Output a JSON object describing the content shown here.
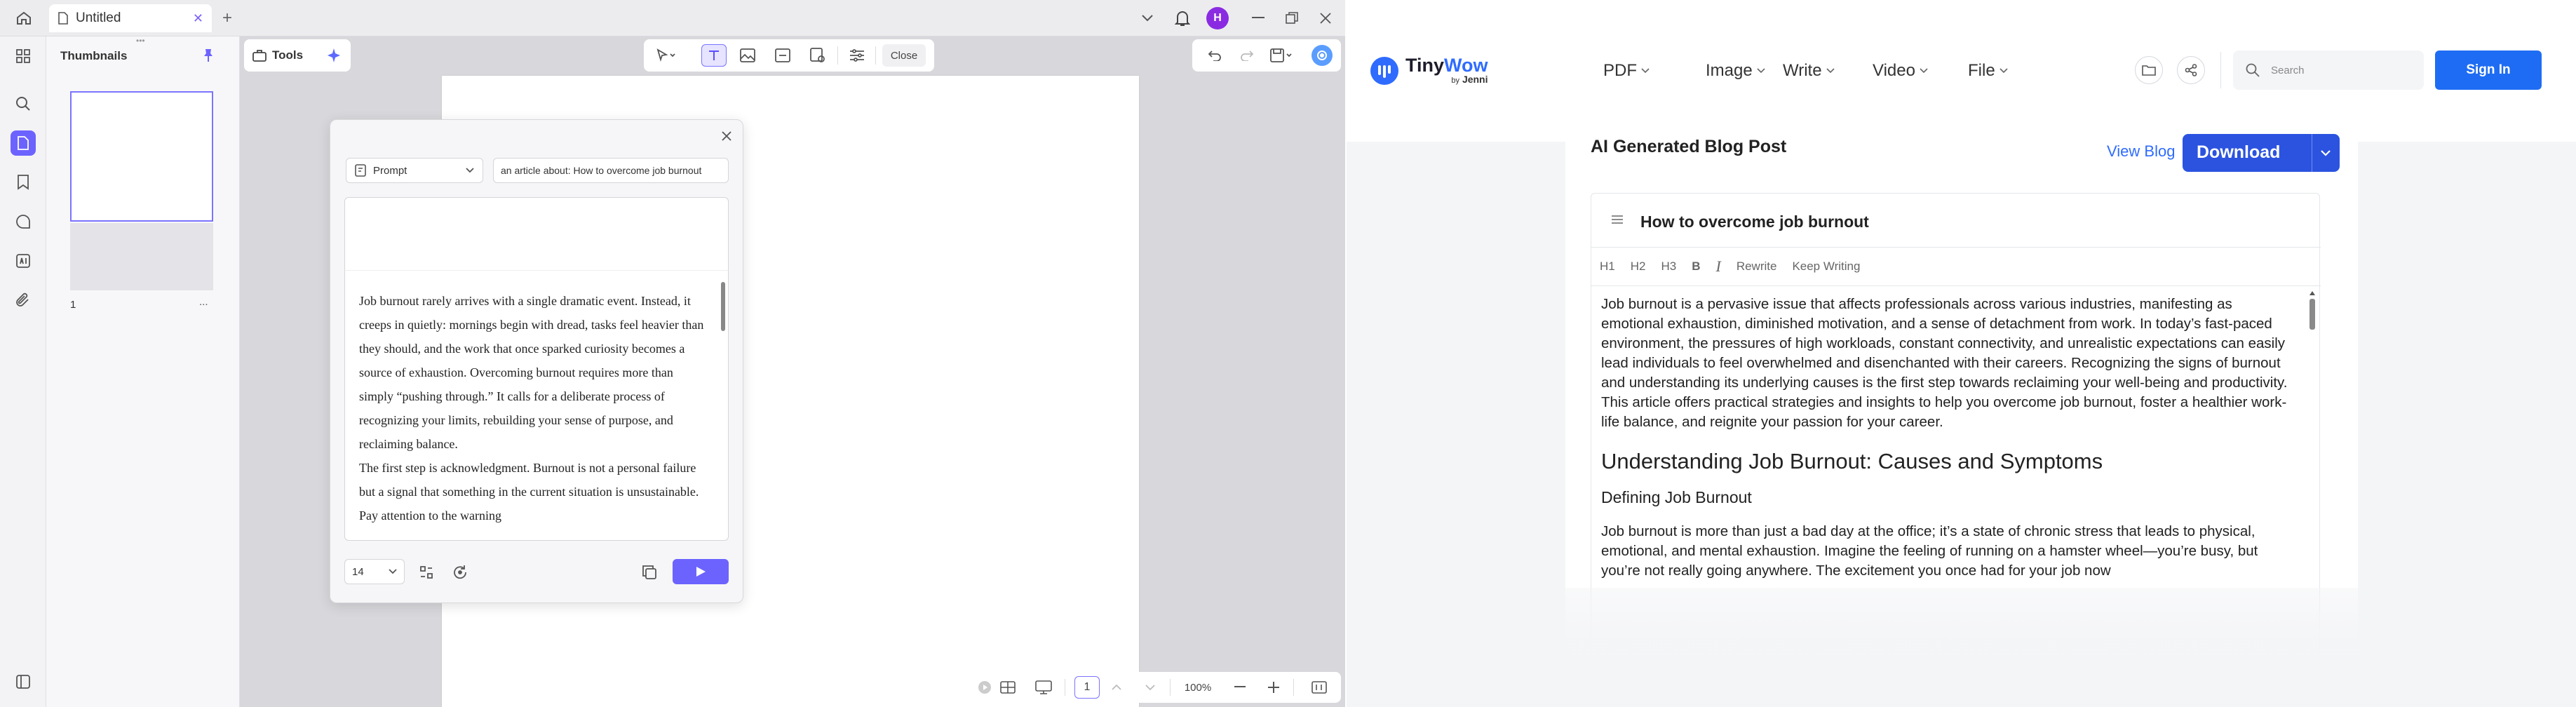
{
  "left_app": {
    "tab_title": "Untitled",
    "avatar_letter": "H",
    "sidebar": {
      "title": "Thumbnails",
      "page_number": "1",
      "more": "..."
    },
    "toolbar": {
      "tools_label": "Tools",
      "close_label": "Close"
    },
    "dialog": {
      "mode": "Prompt",
      "prompt_value": "an article about: How to overcome job burnout",
      "result_text": "Job burnout rarely arrives with a single dramatic event. Instead, it creeps in quietly: mornings begin with dread, tasks feel heavier than they should, and the work that once sparked curiosity becomes a source of exhaustion. Overcoming burnout requires more than simply “pushing through.” It calls for a deliberate process of recognizing your limits, rebuilding your sense of purpose, and reclaiming balance.",
      "result_text_2": "The first step is acknowledgment. Burnout is not a personal failure but a signal that something in the current situation is unsustainable. Pay attention to the warning",
      "font_size": "14"
    },
    "bottom_bar": {
      "page": "1",
      "zoom": "100%"
    }
  },
  "right_site": {
    "brand": {
      "name_part1": "Tiny",
      "name_part2": "Wow",
      "by": "by",
      "sub": "Jenni"
    },
    "nav": [
      "PDF",
      "Image",
      "Write",
      "Video",
      "File"
    ],
    "search_placeholder": "Search",
    "signin_label": "Sign In",
    "card": {
      "title": "AI Generated Blog Post",
      "view_blog": "View Blog",
      "download": "Download",
      "doc_title": "How to overcome job burnout",
      "toolbar": {
        "h1": "H1",
        "h2": "H2",
        "h3": "H3",
        "bold": "B",
        "italic": "I",
        "rewrite": "Rewrite",
        "keep_writing": "Keep Writing"
      },
      "intro": "Job burnout is a pervasive issue that affects professionals across various industries, manifesting as emotional exhaustion, diminished motivation, and a sense of detachment from work. In today’s fast-paced environment, the pressures of high workloads, constant connectivity, and unrealistic expectations can easily lead individuals to feel overwhelmed and disenchanted with their careers. Recognizing the signs of burnout and understanding its underlying causes is the first step towards reclaiming your well-being and productivity. This article offers practical strategies and insights to help you overcome job burnout, foster a healthier work-life balance, and reignite your passion for your career.",
      "heading": "Understanding Job Burnout: Causes and Symptoms",
      "subheading": "Defining Job Burnout",
      "para2": "Job burnout is more than just a bad day at the office; it’s a state of chronic stress that leads to physical, emotional, and mental exhaustion. Imagine the feeling of running on a hamster wheel—you’re busy, but you’re not really going anywhere. The excitement you once had for your job now"
    }
  }
}
